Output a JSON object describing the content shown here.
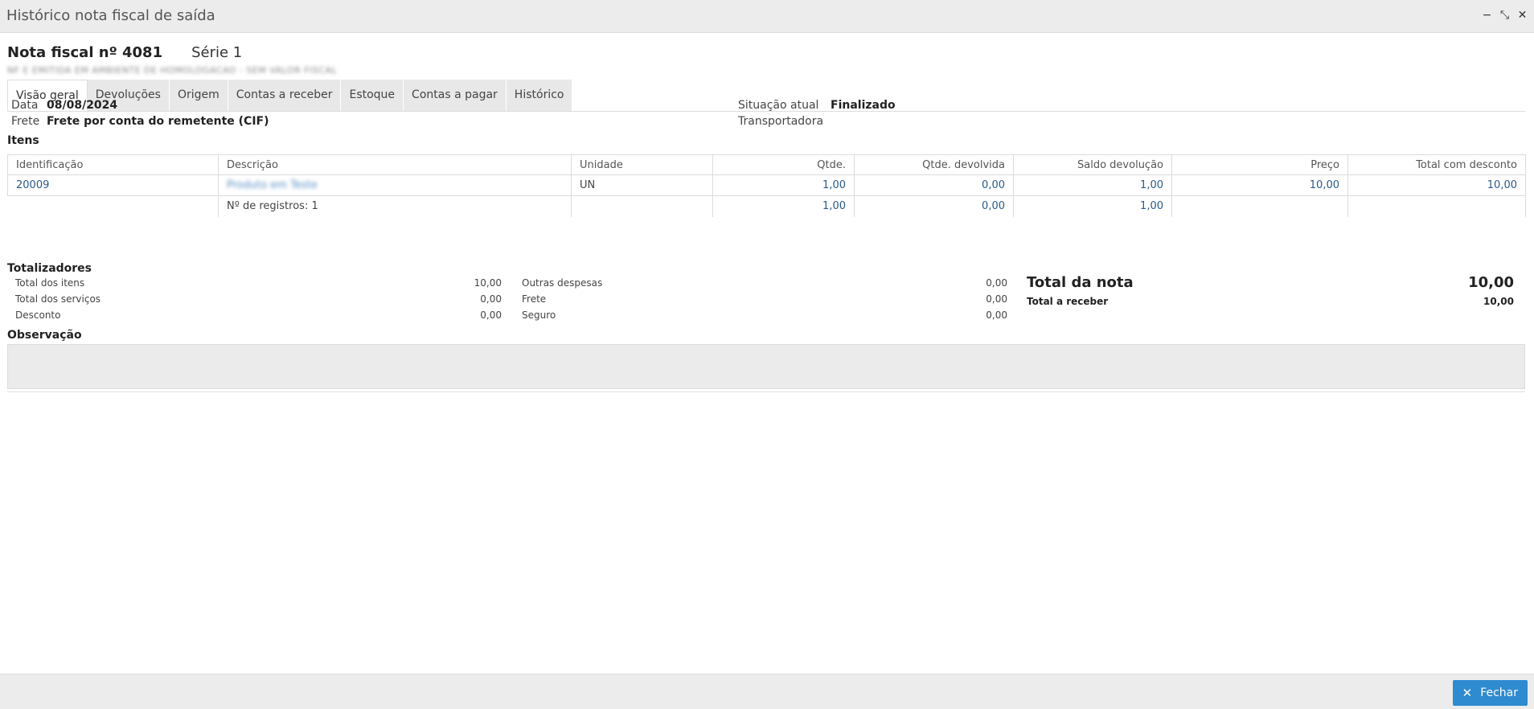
{
  "window": {
    "title": "Histórico nota fiscal de saída",
    "controls": [
      "−",
      "⤡",
      "✕"
    ]
  },
  "header": {
    "nf_number": "Nota fiscal nº 4081",
    "serie": "Série 1",
    "subtitle_redacted": "NF E EMITIDA EM AMBIENTE DE HOMOLOGACAO - SEM VALOR FISCAL"
  },
  "tabs": [
    {
      "label": "Visão geral",
      "active": true
    },
    {
      "label": "Devoluções"
    },
    {
      "label": "Origem"
    },
    {
      "label": "Contas a receber"
    },
    {
      "label": "Estoque"
    },
    {
      "label": "Contas a pagar"
    },
    {
      "label": "Histórico"
    }
  ],
  "overview": {
    "data_label": "Data",
    "data_value": "08/08/2024",
    "frete_label": "Frete",
    "frete_value": "Frete por conta do remetente (CIF)",
    "situacao_label": "Situação atual",
    "situacao_value": "Finalizado",
    "transportadora_label": "Transportadora",
    "transportadora_value": ""
  },
  "items": {
    "title": "Itens",
    "columns": [
      "Identificação",
      "Descrição",
      "Unidade",
      "Qtde.",
      "Qtde. devolvida",
      "Saldo devolução",
      "Preço",
      "Total com desconto"
    ],
    "rows": [
      {
        "id": "20009",
        "descricao": "Produto em Teste",
        "unidade": "UN",
        "qtde": "1,00",
        "qtde_devolvida": "0,00",
        "saldo_devolucao": "1,00",
        "preco": "10,00",
        "total": "10,00"
      }
    ],
    "footer": {
      "registros": "Nº de registros: 1",
      "qtde": "1,00",
      "qtde_devolvida": "0,00",
      "saldo_devolucao": "1,00"
    }
  },
  "totalizadores": {
    "title": "Totalizadores",
    "col1": [
      {
        "label": "Total dos itens",
        "value": "10,00"
      },
      {
        "label": "Total dos serviços",
        "value": "0,00"
      },
      {
        "label": "Desconto",
        "value": "0,00"
      }
    ],
    "col2": [
      {
        "label": "Outras despesas",
        "value": "0,00"
      },
      {
        "label": "Frete",
        "value": "0,00"
      },
      {
        "label": "Seguro",
        "value": "0,00"
      }
    ],
    "total_nota_label": "Total da nota",
    "total_nota_value": "10,00",
    "total_receber_label": "Total a receber",
    "total_receber_value": "10,00"
  },
  "observacao": {
    "title": "Observação"
  },
  "footer": {
    "close_icon": "✕",
    "close_label": "Fechar"
  },
  "colors": {
    "accent": "#2f8bd0",
    "link": "#2a5a8a",
    "bar_bg": "#ececec"
  }
}
